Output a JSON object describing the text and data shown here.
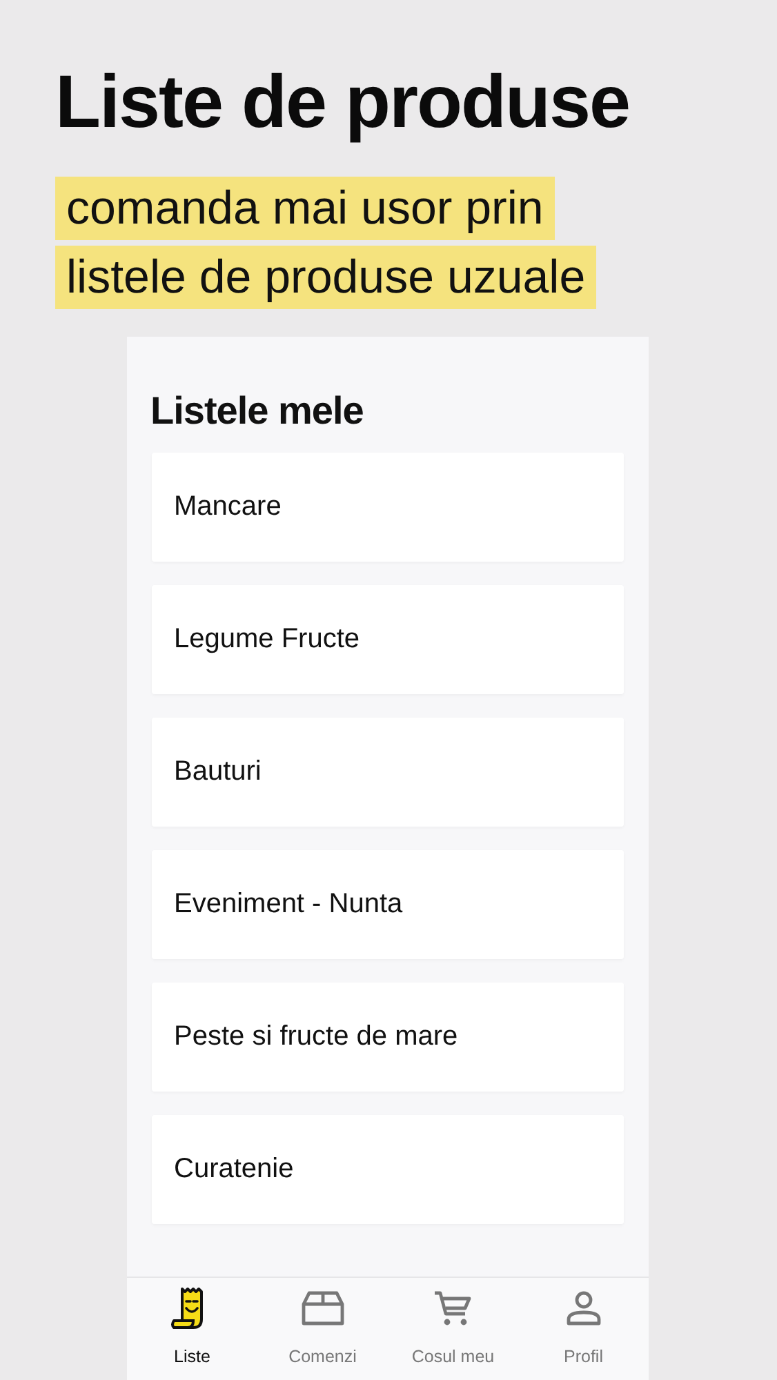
{
  "headline": "Liste de produse",
  "tagline": [
    "comanda mai usor prin",
    "listele de produse uzuale"
  ],
  "screen": {
    "title": "Listele mele",
    "lists": [
      "Mancare",
      "Legume Fructe",
      "Bauturi",
      "Eveniment - Nunta",
      "Peste si fructe de mare",
      "Curatenie"
    ]
  },
  "tab_bar": [
    {
      "label": "Liste",
      "kind": "lists",
      "selected": true
    },
    {
      "label": "Comenzi",
      "kind": "orders",
      "selected": false
    },
    {
      "label": "Cosul meu",
      "kind": "cart",
      "selected": false
    },
    {
      "label": "Profil",
      "kind": "profile",
      "selected": false
    }
  ]
}
